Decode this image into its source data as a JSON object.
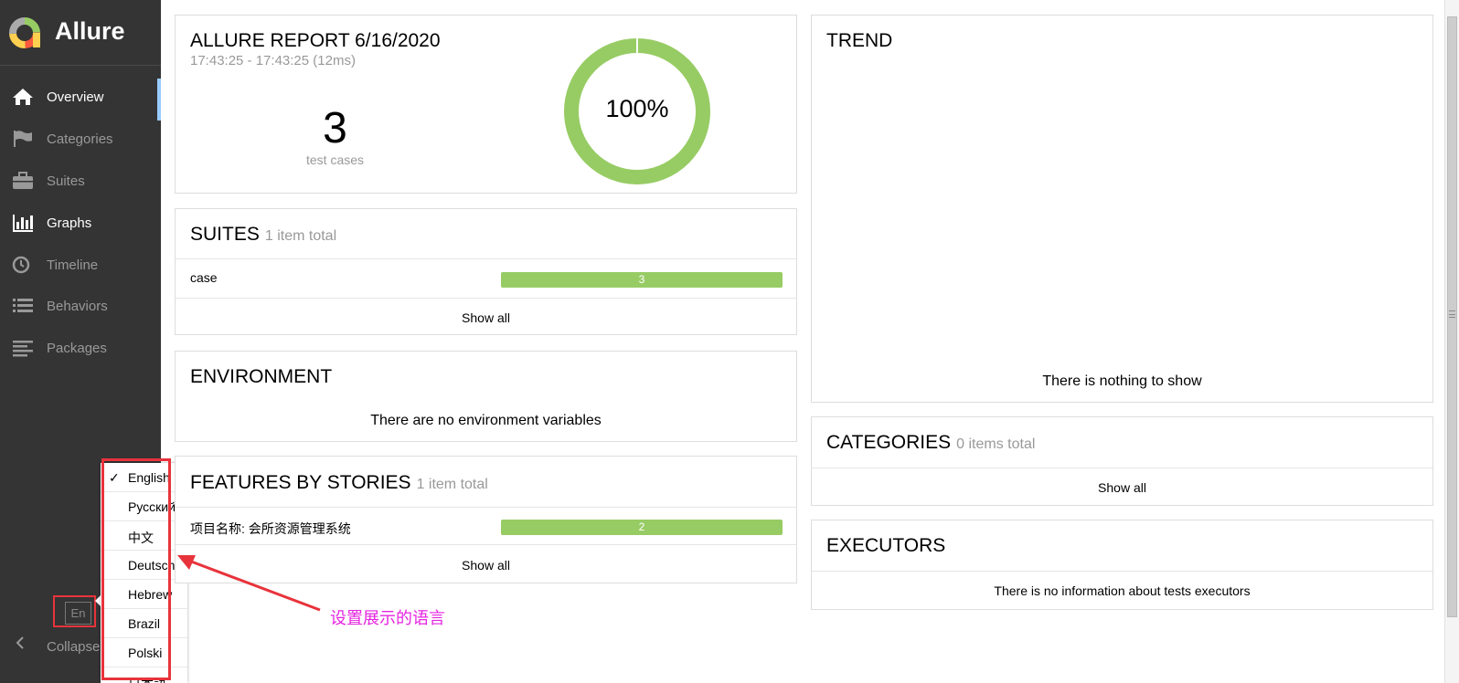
{
  "sidebar": {
    "brand": "Allure",
    "items": [
      {
        "label": "Overview",
        "icon": "home-icon"
      },
      {
        "label": "Categories",
        "icon": "flag-icon"
      },
      {
        "label": "Suites",
        "icon": "briefcase-icon"
      },
      {
        "label": "Graphs",
        "icon": "bar-chart-icon"
      },
      {
        "label": "Timeline",
        "icon": "clock-icon"
      },
      {
        "label": "Behaviors",
        "icon": "list-icon"
      },
      {
        "label": "Packages",
        "icon": "align-left-icon"
      }
    ],
    "active": "Overview",
    "language_button": "En",
    "collapse_label": "Collapse"
  },
  "language_menu": {
    "selected": "English",
    "items": [
      "English",
      "Русский",
      "中文",
      "Deutsch",
      "Hebrew",
      "Brazil",
      "Polski",
      "日本語"
    ]
  },
  "summary": {
    "title": "ALLURE REPORT 6/16/2020",
    "time_range": "17:43:25 - 17:43:25 (12ms)",
    "test_count": "3",
    "test_count_label": "test cases",
    "pass_rate": "100%"
  },
  "suites": {
    "title": "SUITES",
    "count_label": "1 item total",
    "rows": [
      {
        "name": "case",
        "value": "3"
      }
    ],
    "show_all": "Show all"
  },
  "environment": {
    "title": "ENVIRONMENT",
    "empty_text": "There are no environment variables"
  },
  "features": {
    "title": "FEATURES BY STORIES",
    "count_label": "1 item total",
    "rows": [
      {
        "name": "项目名称: 会所资源管理系统",
        "value": "2"
      }
    ],
    "show_all": "Show all"
  },
  "trend": {
    "title": "TREND",
    "empty_text": "There is nothing to show"
  },
  "categories": {
    "title": "CATEGORIES",
    "count_label": "0 items total",
    "show_all": "Show all"
  },
  "executors": {
    "title": "EXECUTORS",
    "empty_text": "There is no information about tests executors"
  },
  "annotation": {
    "text": "设置展示的语言"
  },
  "colors": {
    "sidebar": "#343434",
    "passed": "#97cc64",
    "annotation": "#e524e0",
    "highlight": "#e8333b"
  }
}
